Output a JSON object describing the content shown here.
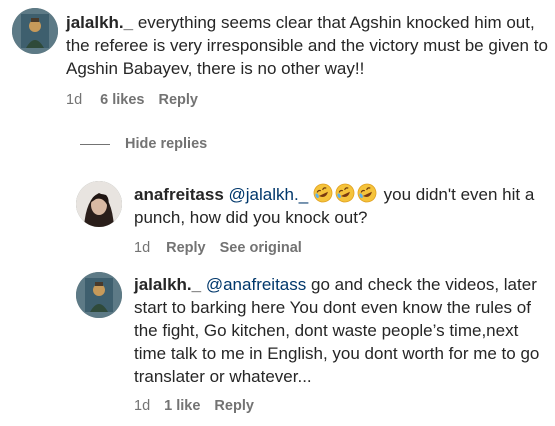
{
  "comments": [
    {
      "username": "jalalkh._",
      "text": " everything seems clear that Agshin knocked him out, the referee is very irresponsible and the victory must be given to Agshin Babayev, there is no other way!!",
      "time": "1d",
      "likes": "6 likes",
      "reply_label": "Reply"
    }
  ],
  "hide_replies_label": "Hide replies",
  "replies": [
    {
      "username": "anafreitass",
      "mention": "@jalalkh._",
      "emojis": [
        "rofl-emoji",
        "rofl-emoji",
        "rofl-emoji"
      ],
      "text": " you didn't even hit a punch, how did you knock out?",
      "time": "1d",
      "reply_label": "Reply",
      "see_original_label": "See original"
    },
    {
      "username": "jalalkh._",
      "mention": "@anafreitass",
      "text": " go and check the videos, later start to barking here You dont even know the rules of the fight, Go kitchen, dont waste people’s time,next time talk to me in English, you dont worth for me to go translater or whatever...",
      "time": "1d",
      "likes": "1 like",
      "reply_label": "Reply"
    }
  ],
  "colors": {
    "text": "#262626",
    "meta": "#737373",
    "mention": "#00376b"
  }
}
